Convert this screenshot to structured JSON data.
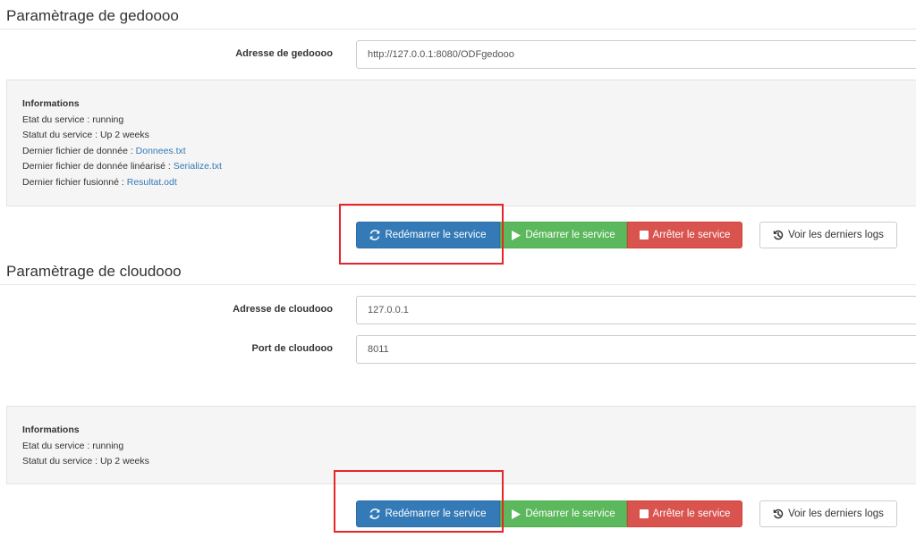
{
  "gedoooSection": {
    "title": "Paramètrage de gedoooo",
    "address": {
      "label": "Adresse de gedoooo",
      "value": "http://127.0.0.1:8080/ODFgedooo"
    },
    "info": {
      "title": "Informations",
      "state_prefix": "Etat du service : ",
      "state_value": "running",
      "status_prefix": "Statut du service : ",
      "status_value": "Up 2 weeks",
      "data_file_prefix": "Dernier fichier de donnée : ",
      "data_file_link": "Donnees.txt",
      "linear_file_prefix": "Dernier fichier de donnée linéarisé : ",
      "linear_file_link": "Serialize.txt",
      "merged_file_prefix": "Dernier fichier fusionné : ",
      "merged_file_link": "Resultat.odt"
    },
    "buttons": {
      "restart": "Redémarrer le service",
      "start": "Démarrer le service",
      "stop": "Arrêter le service",
      "logs": "Voir les derniers logs"
    }
  },
  "cloudoooSection": {
    "title": "Paramètrage de cloudooo",
    "address": {
      "label": "Adresse de cloudooo",
      "value": "127.0.0.1"
    },
    "port": {
      "label": "Port de cloudooo",
      "value": "8011"
    },
    "info": {
      "title": "Informations",
      "state_prefix": "Etat du service : ",
      "state_value": "running",
      "status_prefix": "Statut du service : ",
      "status_value": "Up 2 weeks"
    },
    "buttons": {
      "restart": "Redémarrer le service",
      "start": "Démarrer le service",
      "stop": "Arrêter le service",
      "logs": "Voir les derniers logs"
    }
  },
  "colors": {
    "primary": "#337ab7",
    "success": "#5cb85c",
    "danger": "#d9534f",
    "highlight": "#e8262a",
    "link": "#337ab7",
    "panel": "#f5f5f5"
  },
  "icons": {
    "restart": "refresh-icon",
    "start": "play-icon",
    "stop": "stop-icon",
    "logs": "history-icon"
  }
}
